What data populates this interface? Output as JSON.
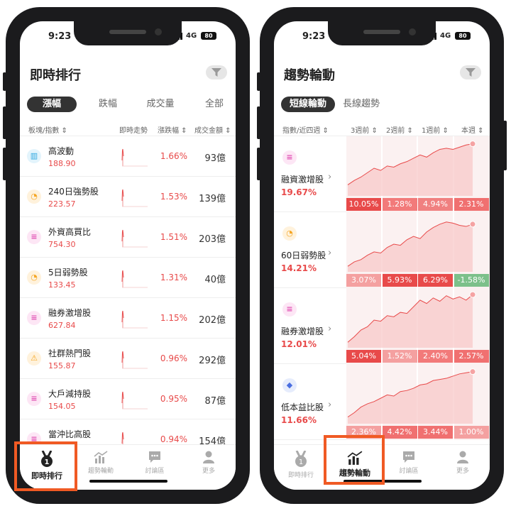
{
  "status": {
    "time": "9:23",
    "network": "4G",
    "battery": "80"
  },
  "left": {
    "title": "即時排行",
    "tabs": [
      "漲幅",
      "跌幅",
      "成交量",
      "全部"
    ],
    "columns": [
      "板塊/指數 ⇕",
      "即時走勢",
      "漲跌幅 ⇕",
      "成交金額 ⇕"
    ],
    "rows": [
      {
        "name": "高波動",
        "price": "188.90",
        "change": "1.66%",
        "amount": "93億",
        "icon": "building-icon",
        "icon_color": "#2ea7e0",
        "icon_bg": "#e3f4fc",
        "glyph": "▥"
      },
      {
        "name": "240日強勢股",
        "price": "223.57",
        "change": "1.53%",
        "amount": "139億",
        "icon": "gauge-icon",
        "icon_color": "#f5a623",
        "icon_bg": "#fff2dc",
        "glyph": "◔"
      },
      {
        "name": "外資高買比",
        "price": "754.30",
        "change": "1.51%",
        "amount": "203億",
        "icon": "coins-icon",
        "icon_color": "#e052b4",
        "icon_bg": "#fde6f5",
        "glyph": "≡"
      },
      {
        "name": "5日弱勢股",
        "price": "133.45",
        "change": "1.31%",
        "amount": "40億",
        "icon": "gauge-icon",
        "icon_color": "#f5a623",
        "icon_bg": "#fff2dc",
        "glyph": "◔"
      },
      {
        "name": "融券激增股",
        "price": "627.84",
        "change": "1.15%",
        "amount": "202億",
        "icon": "coins-icon",
        "icon_color": "#e052b4",
        "icon_bg": "#fde6f5",
        "glyph": "≡"
      },
      {
        "name": "社群熱門股",
        "price": "155.87",
        "change": "0.96%",
        "amount": "292億",
        "icon": "warning-icon",
        "icon_color": "#f5a623",
        "icon_bg": "#fff2dc",
        "glyph": "⚠"
      },
      {
        "name": "大戶減持股",
        "price": "154.05",
        "change": "0.95%",
        "amount": "87億",
        "icon": "coins-icon",
        "icon_color": "#e052b4",
        "icon_bg": "#fde6f5",
        "glyph": "≡"
      },
      {
        "name": "當沖比高股",
        "price": "",
        "change": "0.94%",
        "amount": "154億",
        "icon": "coins-icon",
        "icon_color": "#e052b4",
        "icon_bg": "#fde6f5",
        "glyph": "≡"
      }
    ]
  },
  "right": {
    "title": "趨勢輪動",
    "tabs": [
      "短線輪動",
      "長線趨勢"
    ],
    "columns": [
      "指數/近四週 ⇕",
      "3週前 ⇕",
      "2週前 ⇕",
      "1週前 ⇕",
      "本週 ⇕"
    ],
    "rows": [
      {
        "name": "融資激增股",
        "pct": "19.67%",
        "icon": "coins-icon",
        "icon_color": "#e052b4",
        "icon_bg": "#fde6f5",
        "glyph": "≡",
        "weeks": [
          "10.05%",
          "1.28%",
          "4.94%",
          "2.31%"
        ],
        "week_colors": [
          "#e84a4a",
          "#f27a7a",
          "#f08080",
          "#f07070"
        ],
        "trend": [
          20,
          28,
          34,
          42,
          50,
          46,
          54,
          52,
          58,
          62,
          68,
          74,
          70,
          78,
          84,
          86,
          84,
          88,
          92,
          94
        ]
      },
      {
        "name": "60日弱勢股",
        "pct": "14.21%",
        "icon": "gauge-icon",
        "icon_color": "#f5a623",
        "icon_bg": "#fff2dc",
        "glyph": "◔",
        "weeks": [
          "3.07%",
          "5.93%",
          "6.29%",
          "-1.58%"
        ],
        "week_colors": [
          "#f4a0a0",
          "#e84a4a",
          "#e84a4a",
          "#7cc08a"
        ],
        "trend": [
          10,
          18,
          22,
          30,
          36,
          34,
          44,
          50,
          48,
          58,
          64,
          60,
          72,
          80,
          86,
          90,
          88,
          84,
          82,
          86
        ]
      },
      {
        "name": "融券激增股",
        "pct": "12.01%",
        "icon": "coins-icon",
        "icon_color": "#e052b4",
        "icon_bg": "#fde6f5",
        "glyph": "≡",
        "weeks": [
          "5.04%",
          "1.52%",
          "2.40%",
          "2.57%"
        ],
        "week_colors": [
          "#e84a4a",
          "#f4a0a0",
          "#f27a7a",
          "#f07070"
        ],
        "trend": [
          10,
          20,
          32,
          38,
          50,
          48,
          58,
          56,
          64,
          62,
          74,
          86,
          80,
          90,
          84,
          94,
          88,
          92,
          86,
          96
        ]
      },
      {
        "name": "低本益比股",
        "pct": "11.66%",
        "icon": "diamond-icon",
        "icon_color": "#4a6ee0",
        "icon_bg": "#e6ecfc",
        "glyph": "◆",
        "weeks": [
          "2.36%",
          "4.42%",
          "3.44%",
          "1.00%"
        ],
        "week_colors": [
          "#f4a0a0",
          "#f07070",
          "#f07070",
          "#f4a0a0"
        ],
        "trend": [
          12,
          20,
          30,
          36,
          40,
          46,
          52,
          50,
          58,
          60,
          64,
          70,
          72,
          78,
          80,
          82,
          86,
          90,
          92,
          94
        ]
      }
    ]
  },
  "tabbar": {
    "items": [
      "即時排行",
      "趨勢輪動",
      "討論區",
      "更多"
    ]
  },
  "colors": {
    "up": "#e84a4a",
    "down": "#7cc08a",
    "accent": "#f05a24",
    "fill": "#fde3e3"
  }
}
